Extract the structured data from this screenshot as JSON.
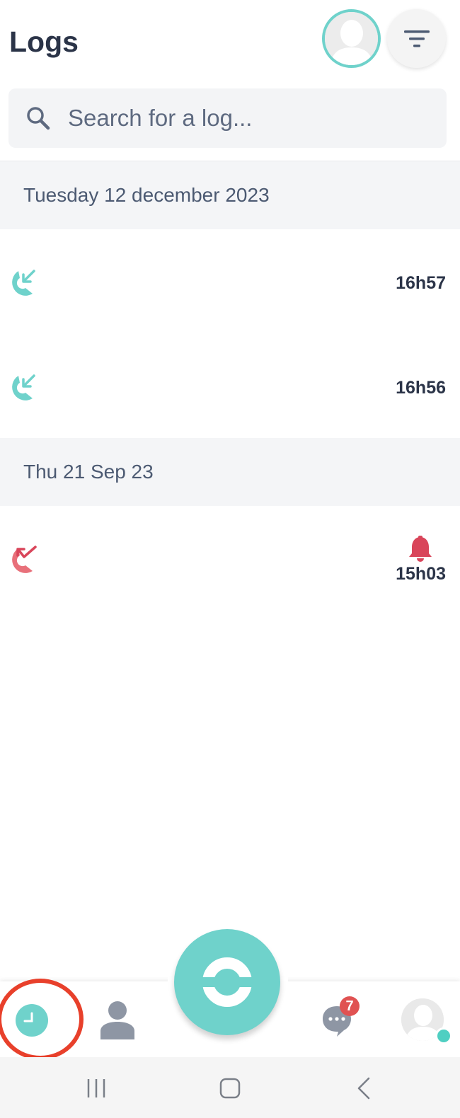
{
  "header": {
    "title": "Logs",
    "avatar_icon": "user-avatar-placeholder",
    "filter_icon": "filter-lines-icon"
  },
  "search": {
    "placeholder": "Search for a log...",
    "icon": "search-icon"
  },
  "sections": [
    {
      "date": "Tuesday 12 december 2023",
      "logs": [
        {
          "type": "incoming",
          "icon": "incoming-call-icon",
          "time": "16h57"
        },
        {
          "type": "incoming",
          "icon": "incoming-call-icon",
          "time": "16h56"
        }
      ]
    },
    {
      "date": "Thu 21 Sep 23",
      "logs": [
        {
          "type": "missed",
          "icon": "missed-call-icon",
          "time": "15h03",
          "alert_icon": "bell-icon"
        }
      ]
    }
  ],
  "bottom_nav": {
    "items": [
      {
        "name": "recent",
        "icon": "clock-icon",
        "active": true
      },
      {
        "name": "contacts",
        "icon": "person-icon"
      },
      {
        "name": "dialer",
        "icon": "phone-fab-icon"
      },
      {
        "name": "messages",
        "icon": "chat-bubble-icon",
        "badge": "7"
      },
      {
        "name": "profile",
        "icon": "user-avatar-placeholder"
      }
    ]
  },
  "system_nav": {
    "items": [
      "recents-icon",
      "home-icon",
      "back-icon"
    ]
  },
  "colors": {
    "accent": "#6fd2cb",
    "missed": "#e8707a",
    "alert": "#d9455a",
    "badge": "#e05252",
    "highlight": "#e8402b",
    "text_dark": "#2b3448",
    "section_bg": "#f4f5f7"
  }
}
